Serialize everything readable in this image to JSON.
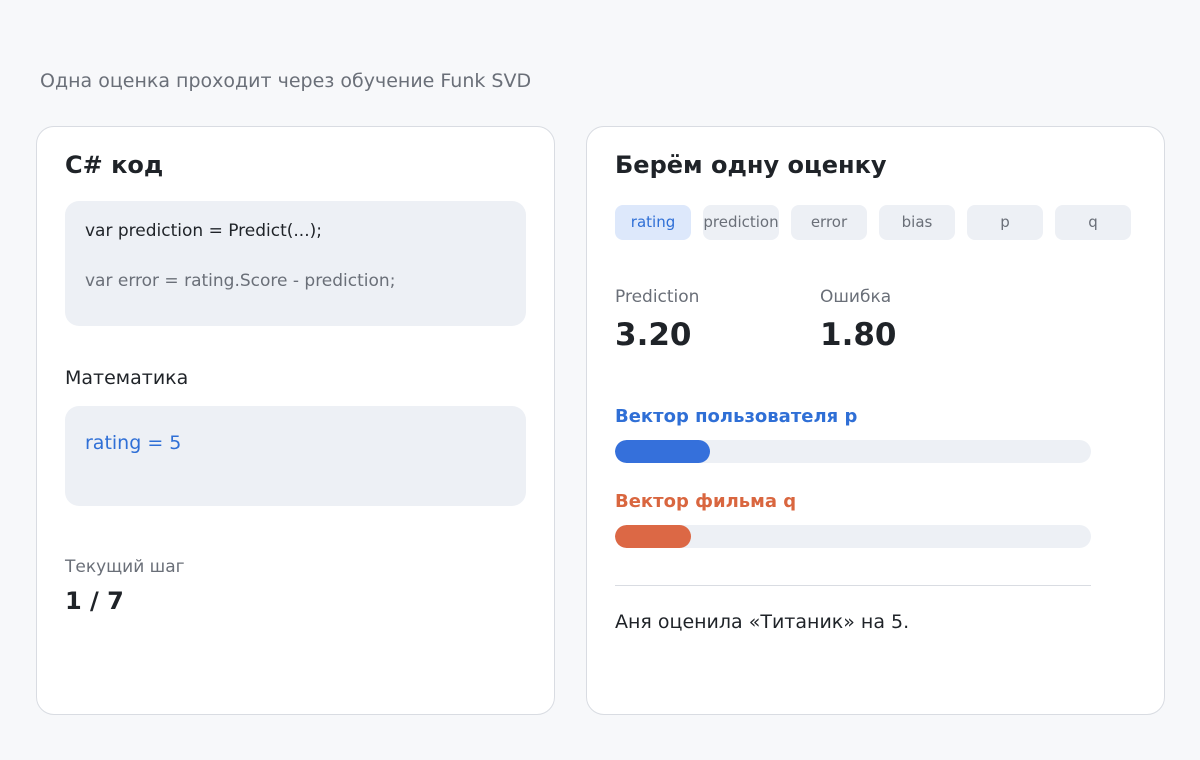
{
  "header": {
    "title": "",
    "subtitle": "Одна оценка проходит через обучение Funk SVD"
  },
  "code_panel": {
    "title": "C# код",
    "code_lines": [
      "var prediction = Predict(...);",
      "var error = rating.Score - prediction;"
    ],
    "math_label": "Математика",
    "math_line": "rating = 5",
    "step_label": "Текущий шаг",
    "step_value": "1 / 7"
  },
  "visual_panel": {
    "title": "Берём одну оценку",
    "tabs": [
      "rating",
      "prediction",
      "error",
      "bias",
      "p",
      "q"
    ],
    "active_tab": "rating",
    "metrics": [
      {
        "label": "Prediction",
        "value": "3.20"
      },
      {
        "label": "Ошибка",
        "value": "1.80"
      }
    ],
    "user_vector": {
      "label": "Вектор пользователя p",
      "fill_fraction": 0.2,
      "color": "#3570db"
    },
    "movie_vector": {
      "label": "Вектор фильма q",
      "fill_fraction": 0.16,
      "color": "#dc6845"
    },
    "caption": "Аня оценила «Титаник» на 5."
  },
  "colors": {
    "accent_blue": "#2f6fd6",
    "accent_orange": "#d9663f",
    "panel_bg": "#edf0f5"
  }
}
